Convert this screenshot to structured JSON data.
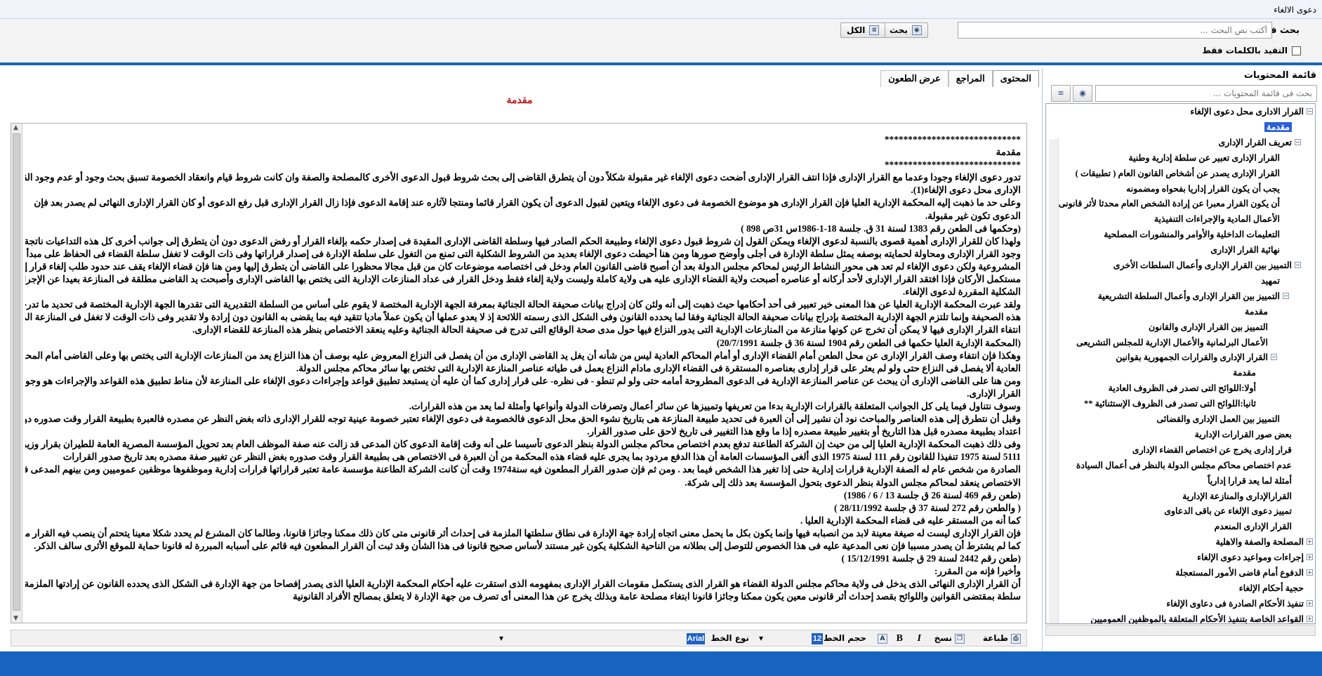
{
  "window": {
    "title": "دعوى الالغاء"
  },
  "search": {
    "label": "بحث فى :",
    "placeholder": "أكتب نص البحث ...",
    "search_button": "بحث",
    "all_button": "الكل",
    "exact_label": "التقيد بالكلمات فقط"
  },
  "toc": {
    "title": "قائمة المحتويات",
    "search_placeholder": "بحث فى قائمة المحتويات ...",
    "items": [
      {
        "label": "القرار الادارى محل دعوى الإلغاء",
        "level": 0,
        "expanded": true
      },
      {
        "label": "مقدمة",
        "level": 1,
        "selected": true
      },
      {
        "label": "تعريف القرار الإدارى",
        "level": 1,
        "expanded": true
      },
      {
        "label": "القرار الإدارى تعبير عن سلطة إدارية وطنية",
        "level": 2
      },
      {
        "label": "القرار الإدارى يصدر عن أشخاص القانون العام ( تطبيقات )",
        "level": 2
      },
      {
        "label": "يجب أن يكون القرار إداريا بفحواه ومضمونه",
        "level": 2
      },
      {
        "label": "أن يكون القرار معبرا عن إرادة الشخص العام محدثا لأثر قانونى",
        "level": 2
      },
      {
        "label": "الأعمال المادية والإجراءات التنفيذية",
        "level": 2
      },
      {
        "label": "التعليمات الداخلية والأوامر والمنشورات المصلحية",
        "level": 2
      },
      {
        "label": "نهائية القرار الإدارى",
        "level": 2
      },
      {
        "label": "التمييز بين القرار الإدارى وأعمال السلطات الأخرى",
        "level": 1,
        "expanded": true
      },
      {
        "label": "تمهيد",
        "level": 2
      },
      {
        "label": "التمييز بين القرار الإدارى وأعمال السلطة التشريعية",
        "level": 2,
        "expanded": true
      },
      {
        "label": "مقدمة",
        "level": 3
      },
      {
        "label": "التمييز بين القرار الإدارى والقانون",
        "level": 3
      },
      {
        "label": "الأعمال البرلمانية والأعمال الإدارية للمجلس التشريعى",
        "level": 3
      },
      {
        "label": "القرار الإدارى والقرارات الجمهورية بقوانين",
        "level": 3,
        "expanded": true
      },
      {
        "label": "مقدمة",
        "level": 4
      },
      {
        "label": "أولا:اللوائح التى تصدر فى الظروف العادية",
        "level": 4
      },
      {
        "label": "ثانيا:اللوائح التى تصدر فى الظروف الإستثنائية **",
        "level": 4
      },
      {
        "label": "التمييز بين العمل الإدارى والقضائى",
        "level": 2
      },
      {
        "label": "بعض صور القرارات الإدارية",
        "level": 1
      },
      {
        "label": "قرار إدارى يخرج عن اختصاص القضاء الإدارى",
        "level": 1
      },
      {
        "label": "عدم اختصاص محاكم مجلس الدولة بالنظر فى أعمال السيادة",
        "level": 1
      },
      {
        "label": "أمثلة لما يعد قرارا إدارياً",
        "level": 1
      },
      {
        "label": "القرارالإدارى والمنازعة الإدارية",
        "level": 1
      },
      {
        "label": "تمييز دعوى الإلغاء عن باقى الدعاوى",
        "level": 1
      },
      {
        "label": "القرار الإدارى المنعدم",
        "level": 1
      },
      {
        "label": "المصلحة والصفة والاهلية",
        "level": 0,
        "collapsed": true
      },
      {
        "label": "إجراءات ومواعيد دعوى الإلغاء",
        "level": 0,
        "collapsed": true
      },
      {
        "label": "الدفوع أمام قاضى الأمور المستعجلة",
        "level": 0,
        "collapsed": true
      },
      {
        "label": "حجية أحكام الإلغاء",
        "level": 0
      },
      {
        "label": "تنفيذ الأحكام الصادرة فى دعاوى الإلغاء",
        "level": 0,
        "collapsed": true
      },
      {
        "label": "القواعد الخاصة بتنفيذ الأحكام المتعلقة بالموظفين العموميين",
        "level": 0,
        "collapsed": true
      }
    ]
  },
  "tabs": [
    {
      "label": "المحتوى",
      "active": true
    },
    {
      "label": "المراجع",
      "active": false
    },
    {
      "label": "عرض الطعون",
      "active": false
    }
  ],
  "content": {
    "heading": "مقدمة",
    "lines": [
      "*****************************",
      "مقدمة",
      "*****************************",
      "تدور دعوى الإلغاء وجودا وعدما مع القرار الإدارى فإذا انتف القرار الإدارى أضحت دعوى الإلغاء غير مقبولة شكلاً دون أن يتطرق  القاضى إلى بحث شروط قبول الدعوى الأخرى كالمصلحة والصفة وان كانت شروط قيام وانعقاد الخصومة تسبق بحث وجود أو عدم وجود القرار",
      "الإدارى محل دعوى الإلغاء(1).",
      "وعلى حد ما ذهبت إليه المحكمة الإدارية العليا فإن القرار الإدارى هو موضوع الخصومة فى دعوى الإلغاء ويتعين لقبول الدعوى أن يكون القرار قائما ومنتجا لآثاره عند إقامة الدعوى فإذا زال القرار الإدارى قبل رفع الدعوى أو كان القرار الإدارى النهائى لم يصدر بعد فإن",
      "الدعوى تكون غير مقبولة.",
      "(وحكمها فى الطعن رقم 1383 لسنة 31 ق. جلسة 18-1-1986س 31ص 898 )",
      "ولهذا كان للقرار الإدارى أهمية قصوى بالنسبة لدعوى الإلغاء ويمكن القول إن شروط قبول دعوى الإلغاء وطبيعة الحكم الصادر فيها وسلطة القاضى الإدارى المقيدة فى إصدار حكمه بإلغاء القرار أو رفض الدعوى دون أن يتطرق إلى جوانب أخرى كل هذه التداعيات ناتجة عن",
      "وجود القرار الإدارى ومحاولة لحمايته بوصفه يمثل سلطة الإدارة فى أجلى وأوضح صورها ومن هنا أحيطت دعوى الإلغاء بعديد من الشروط الشكلية التى تمنع من التغول على سلطة الإدارة فى إصدار قراراتها وفى ذات الوقت لا تغفل سلطة القضاء فى الحفاظ على مبدأ",
      "المشروعية ولكن دعوى الإلغاء لم تعد هى محور النشاط الرئيس لمحاكم مجلس الدولة بعد أن أصبح قاضى القانون العام ودخل فى اختصاصه موضوعات كان من قبل مجالا محظورا على القاضى أن يتطرق إليها ومن هنا فإن قضاء الإلغاء يقف عند حدود طلب إلغاء قرار إدارى",
      "مستكمل الأركان فإذا افتقد القرار الإدارى لأحد أركانه أو عناصره أصبحت ولاية القضاء الإدارى عليه هى ولاية كاملة وليست ولاية إلغاء فقط ودخل القرار فى عداد المنازعات الإدارية التى يختص بها القاضى الإدارى وأصبحت يد القاضى مطلقة فى المنازعة بعيدا عن الإجراءات",
      "الشكلية المقررة لدعوى الإلغاء.",
      "ولقد عبرت المحكمة الإدارية العليا عن هذا المعنى خير تعبير فى أحد أحكامها حيث ذهبت إلى أنه ولئن كان إدراج بيانات صحيفة الحالة الجنائية بمعرفة الجهة الإدارية المختصة لا يقوم على أساس من السلطة التقديرية التى تقدرها الجهة الإدارية المختصة فى تحديد ما تدرجه فى",
      "هذه الصحيفة وإنما تلتزم الجهة الإدارية المختصة بإدراج بيانات صحيفة الحالة الجنائية وفقا لما يحدده القانون وفى الشكل الذى رسمته اللائحة إذ لا يعدو عملها أن يكون عملاً ماديا تتقيد فيه بما يقضى به القانون دون إرادة ولا تقدير وفى ذات الوقت لا تغفل فى المنازعة المماثلة وأيا كان الرأى فى مدى",
      "انتفاء القرار الإدارى فيها لا يمكن أن تخرج عن كونها منازعة من المنازعات الإدارية التى يدور النزاع فيها حول مدى صحة الوقائع التى تدرج فى صحيفة الحالة الجنائية وعليه ينعقد الاختصاص بنظر هذه المنازعة للقضاء الإدارى.",
      "(المحكمة الإدارية العليا حكمها فى الطعن رقم 1904 لسنة 36 ق جلسة 20/7/1991)",
      "وهكذا فإن انتفاء وصف القرار الإدارى عن محل الطعن أمام القضاء الإدارى أو أمام المحاكم العادية ليس من شأنه أن يغل يد القاضى الإدارى من أن يفصل فى النزاع المعروض عليه بوصف أن هذا النزاع يعد من المنازعات الإدارية التى يختص بها وعلى القاضى أمام المحاكم",
      "العادية ألا يفصل فى النزاع حتى ولو لم يعثر على قرار إدارى بعناصره المستقرة فى القضاء الإدارى مادام النزاع يعمل فى طياته عناصر المنازعة الإدارية التى تختص بها سائر محاكم مجلس الدولة.",
      "ومن هنا على القاضى الإدارى أن يبحث عن عناصر المنازعة الإدارية فى الدعوى المطروحة أمامه حتى ولو لم تنطو - فى نظره- على قرار إدارى كما أن عليه أن يستبعد تطبيق قواعد وإجراءات دعوى الإلغاء على المنازعة لأن مناط تطبيق هذه القواعد والإجراءات هو وجود",
      "القرار الإدارى.",
      "وسوف نتناول فيما يلى كل الجوانب المتعلقة بالقرارات الإدارية بدءا من تعريفها وتمييزها عن سائر أعمال وتصرفات الدولة وأنواعها وأمثلة لما يعد من هذه القرارات.",
      "وقبل أن نتطرق إلى هذه العناصر والمباحث نود أن نشير إلى أن العبرة فى تحديد طبيعة المنازعة هى بتاريخ نشوء الحق محل الدعوى فالخصومة فى دعوى الإلغاء تعتبر خصومة عينية توجه للقرار الإدارى ذاته بغض النظر عن مصدره فالعبرة بطبيعة القرار وقت صدوره دون",
      "اعتداد بطبيعة مصدره قبل هذا التاريخ أو بتغيير طبيعة مصدره إذا ما وقع هذا التغيير فى تاريخ لاحق على صدور القرار.",
      "وفى ذلك ذهبت المحكمة الإدارية العليا إلى من حيث إن الشركة الطاعنة تدفع بعدم اختصاص محاكم مجلس الدولة بنظر الدعوى تأسيسا على أنه وقت إقامة الدعوى كان المدعى قد زالت عنه صفة الموظف العام بعد تحويل المؤسسة المصرية العامة للطيران بقرار وزير الطيران المدنى رقم",
      "5111 لسنة 1975 تنفيذا للقانون رقم 111 لسنة 1975 الذى ألغى المؤسسات العامة أن هذا الدفع مردود بما يجرى عليه قضاء هذه المحكمة من أن العبرة فى الاختصاص هى بطبيعة القرار وقت صدوره بغض النظر عن تغيير صفة مصدره بعد تاريخ صدور القرارات",
      "الصادرة من شخص عام له الصفة الإدارية قرارات إدارية حتى إذا تغير هذا الشخص فيما بعد . ومن ثم فإن صدور القرار المطعون فيه سنة1974 وقت أن كانت الشركة الطاعنة مؤسسة عامة تعتبر قراراتها قرارات إدارية وموظفوها موظفين عموميين ومن بينهم المدعى فإن",
      "الاختصاص ينعقد لمحاكم مجلس الدولة بنظر الدعوى بتحول المؤسسة بعد ذلك إلى شركة.",
      "(طعن رقم 469 لسنة 26 ق جلسة 13 / 6 / 1986)",
      "( والطعن رقم 272 لسنة 37 ق جلسة 28/11/1992 )",
      "كما أنه من المستقر عليه فى قضاء المحكمة الإدارية العليا .",
      "فإن القرار الإدارى ليست له صيغة معينة لابد من انصبابه فيها وإنما يكون بكل ما يحمل معنى اتجاه إرادة جهة الإدارة فى نطاق سلطتها الملزمة فى إحداث أثر قانونى متى كان ذلك ممكنا وجائزا قانونا، وطالما كان المشرع لم يحدد شكلا معينا يتحتم أن ينصب فيه القرار محل النزاع",
      "كما لم يشترط أن يصدر مسببا فإن نعى المدعية عليه فى هذا الخصوص للتوصل إلى بطلانه من الناحية الشكلية يكون غير مستند لأساس صحيح قانونا فى هذا الشأن وقد ثبت أن القرار المطعون فيه قائم على أسبابه المبررة له قانونا حماية للموقع الأثرى سالف الذكر.",
      "(طعن رقم 2442 لسنة 29 ق جلسة 15/12/1991 )",
      "وأخيرا فإنه من المقرر:",
      "أن القرار الإدارى النهائى الذى يدخل فى ولاية محاكم مجلس الدولة القضاء هو القرار الذى يستكمل مقومات القرار الإدارى بمفهومه الذى استقرت عليه أحكام المحكمة الإدارية العليا الذى يصدر إفصاحا من جهة الإدارة فى الشكل الذى يحدده القانون عن إرادتها الملزمة بمالها من",
      "سلطة بمقتضى القوانين واللوائح بقصد إحداث أثر قانونى معين يكون ممكنا وجائزا قانونا ابتغاء مصلحة عامة وبذلك يخرج عن هذا المعنى أى تصرف من جهة الإدارة لا يتعلق بمصالح الأفراد القانونية"
    ]
  },
  "editor_toolbar": {
    "print": "طباعة",
    "copy": "نسخ",
    "font_size_label": "حجم الخط",
    "font_size_value": "12",
    "font_type_label": "نوع الخط",
    "font_type_value": "Arial",
    "bold_glyph": "B",
    "italic_glyph": "I"
  },
  "colors": {
    "accent": "#1664c0",
    "heading": "#c0141c",
    "selection": "#2b5fd8"
  }
}
